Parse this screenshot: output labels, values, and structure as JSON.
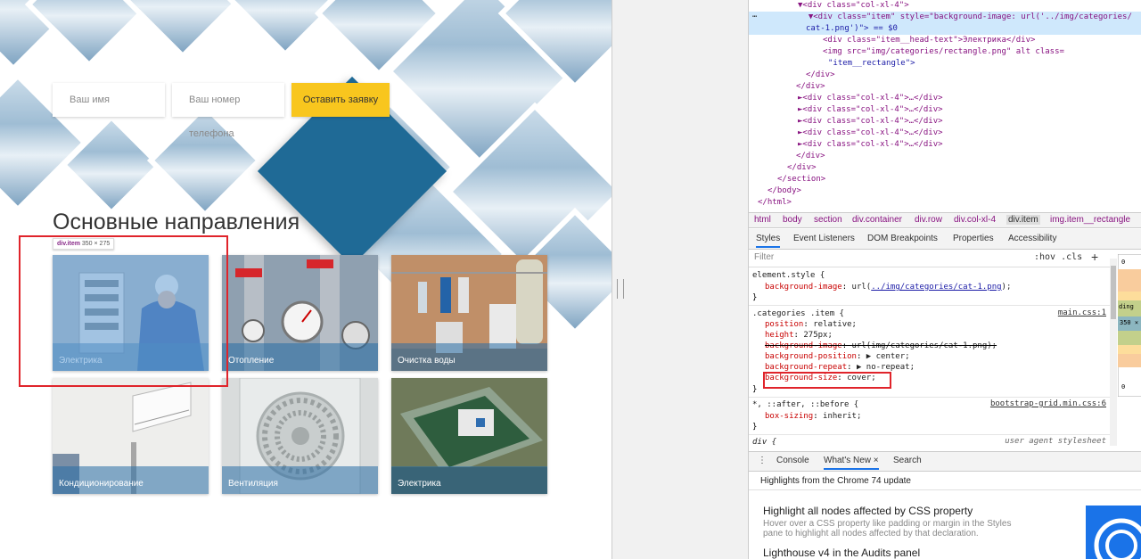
{
  "page": {
    "form": {
      "name_placeholder": "Ваш имя",
      "phone_placeholder": "Ваш номер телефона",
      "submit_label": "Оставить заявку"
    },
    "section_title": "Основные направления",
    "inspect_tooltip": {
      "selector": "div.item",
      "size": "350 × 275"
    },
    "tiles": [
      {
        "label": "Электрика"
      },
      {
        "label": "Отопление"
      },
      {
        "label": "Очистка воды"
      },
      {
        "label": "Кондиционирование"
      },
      {
        "label": "Вентиляция"
      },
      {
        "label": "Электрика"
      }
    ]
  },
  "devtools": {
    "dom": [
      "▼<div class=\"col-xl-4\">",
      "▼<div class=\"item\" style=\"background-image: url('../img/categories/",
      "cat-1.png')\"> == $0",
      "<div class=\"item__head-text\">Электрика</div>",
      "<img src=\"img/categories/rectangle.png\" alt class=",
      "\"item__rectangle\">",
      "</div>",
      "</div>",
      "►<div class=\"col-xl-4\">…</div>",
      "►<div class=\"col-xl-4\">…</div>",
      "►<div class=\"col-xl-4\">…</div>",
      "►<div class=\"col-xl-4\">…</div>",
      "►<div class=\"col-xl-4\">…</div>",
      "</div>",
      "</div>",
      "</section>",
      "</body>",
      "</html>"
    ],
    "breadcrumbs": [
      "html",
      "body",
      "section",
      "div.container",
      "div.row",
      "div.col-xl-4",
      "div.item",
      "img.item__rectangle"
    ],
    "tabs": [
      "Styles",
      "Event Listeners",
      "DOM Breakpoints",
      "Properties",
      "Accessibility"
    ],
    "filter_placeholder": "Filter",
    "hov_cls": ":hov .cls",
    "rules": {
      "element_style": {
        "selector": "element.style {",
        "prop": "background-image",
        "value_prefix": "url(",
        "value_link": "../img/categories/cat-1.png",
        "value_suffix": ");"
      },
      "item_rule": {
        "selector": ".categories .item {",
        "source": "main.css:1",
        "props": [
          {
            "name": "position",
            "value": "relative;"
          },
          {
            "name": "height",
            "value": "275px;"
          },
          {
            "name": "background-image",
            "value": "url(img/categories/cat-1.png);"
          },
          {
            "name": "background-position",
            "value": "▶ center;"
          },
          {
            "name": "background-repeat",
            "value": "▶ no-repeat;"
          },
          {
            "name": "background-size",
            "value": "cover;"
          }
        ]
      },
      "universal_rule": {
        "selector": "*, ::after, ::before {",
        "source": "bootstrap-grid.min.css:6",
        "prop": "box-sizing",
        "value": "inherit;"
      },
      "ua_rule": {
        "selector": "div {",
        "source": "user agent stylesheet"
      },
      "close": "}"
    },
    "drawer": {
      "tabs": [
        "Console",
        "What's New ×",
        "Search"
      ],
      "header": "Highlights from the Chrome 74 update",
      "items": [
        {
          "title": "Highlight all nodes affected by CSS property",
          "body": [
            "Hover over a CSS property like padding or margin in the Styles",
            "pane to highlight all nodes affected by that declaration."
          ]
        },
        {
          "title": "Lighthouse v4 in the Audits panel",
          "body": []
        }
      ]
    },
    "box_model": {
      "zero": "0",
      "pad_label": "ding",
      "size": "350 ×"
    }
  },
  "colors": {
    "accent_yellow": "#f8c61e",
    "diamond_blue": "#1f6a96",
    "highlight_red": "#e0242b"
  }
}
